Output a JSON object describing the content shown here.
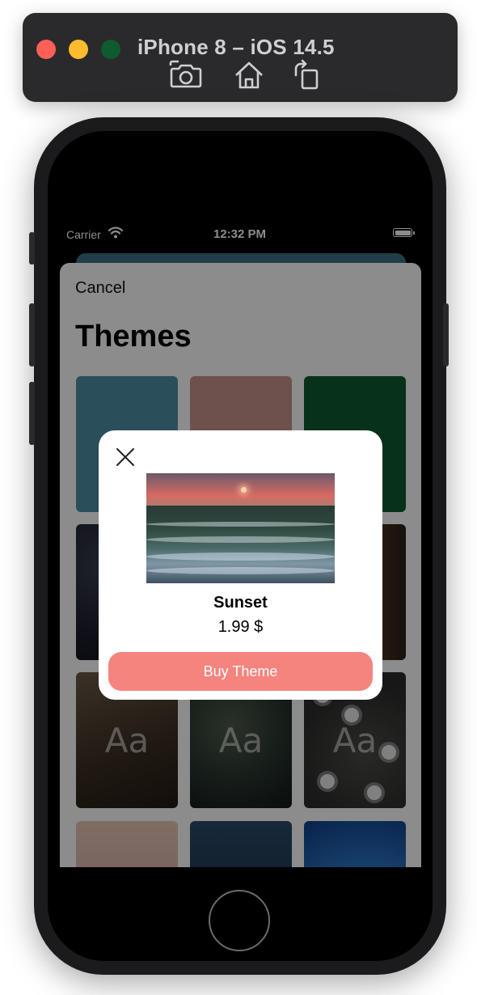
{
  "simulator": {
    "title": "iPhone 8 – iOS 14.5",
    "buttons": [
      "screenshot-icon",
      "home-icon",
      "rotate-icon"
    ]
  },
  "status_bar": {
    "carrier": "Carrier",
    "time": "12:32 PM"
  },
  "sheet": {
    "cancel_label": "Cancel",
    "title": "Themes",
    "tile_glyph": "Aa"
  },
  "modal": {
    "theme_name": "Sunset",
    "price": "1.99 $",
    "buy_label": "Buy Theme",
    "accent_color": "#f5847e"
  }
}
